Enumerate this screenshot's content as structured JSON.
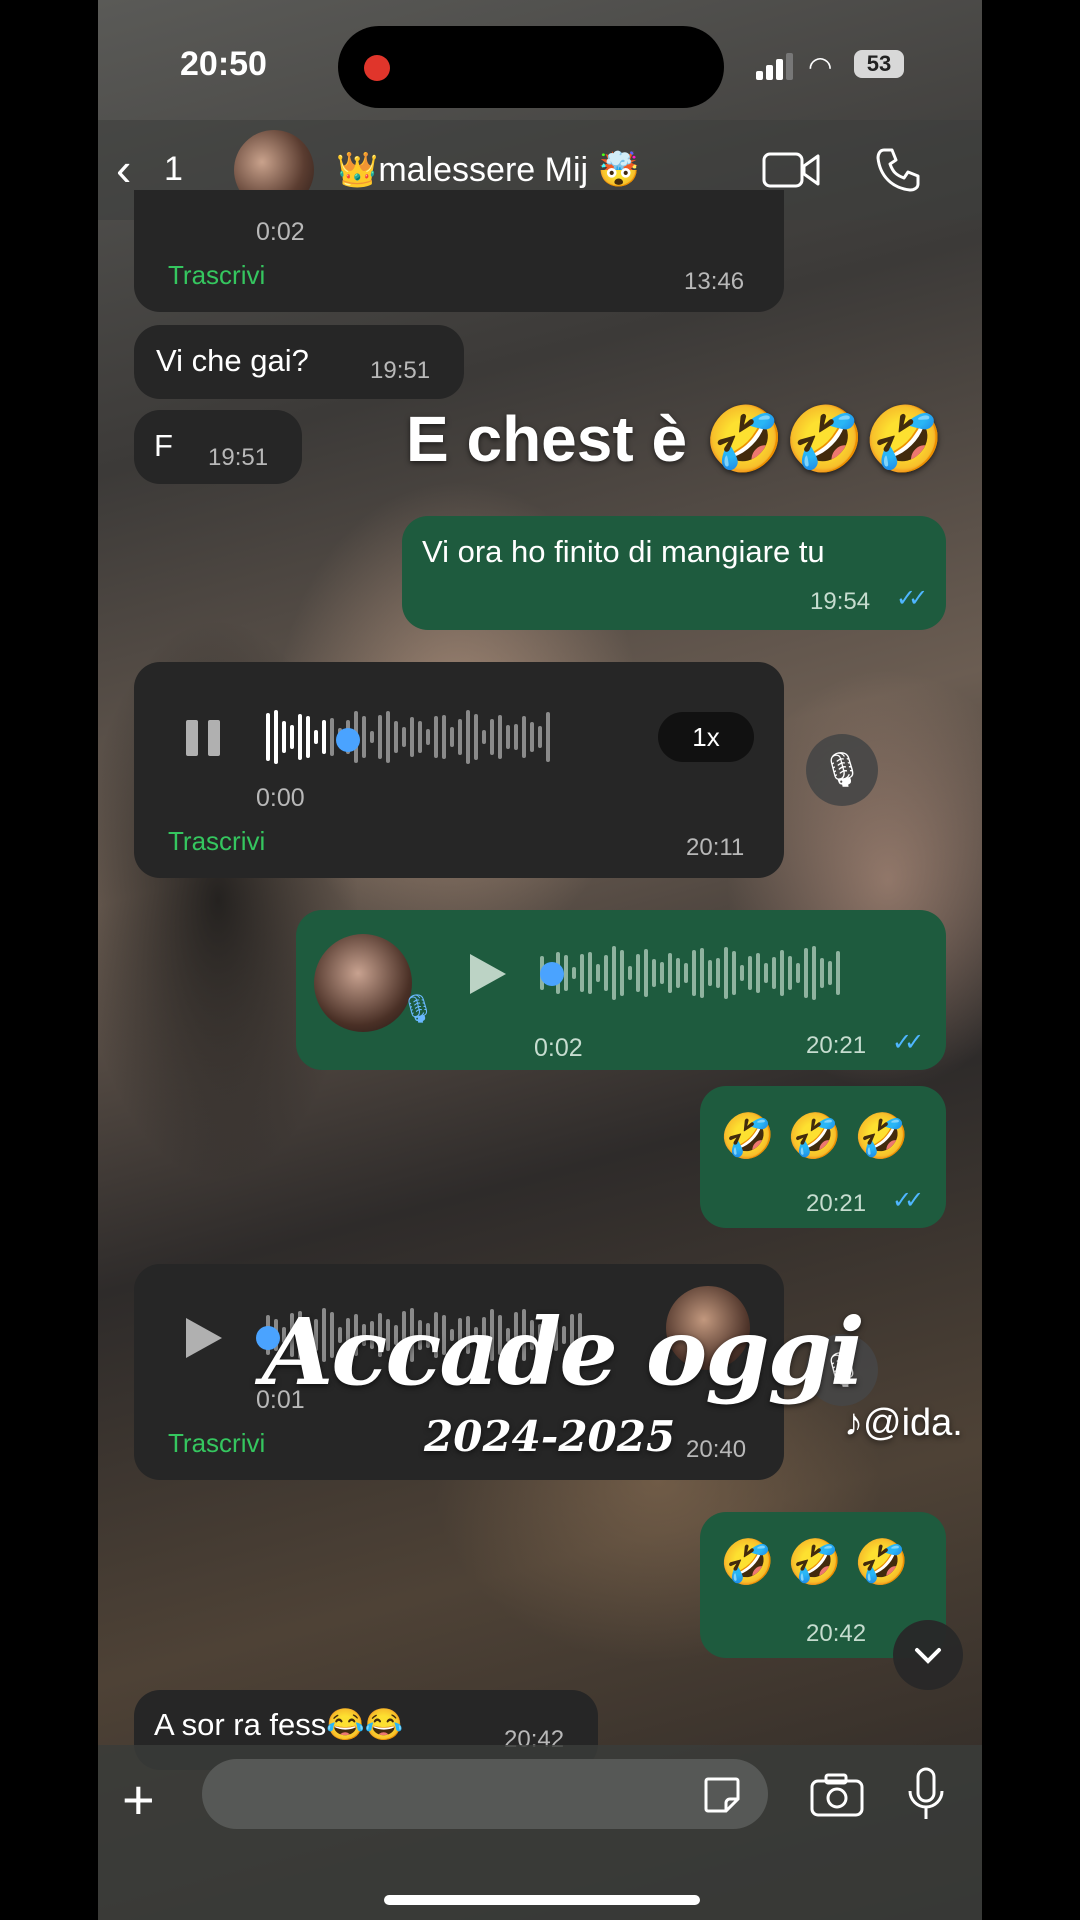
{
  "status_bar": {
    "time": "20:50",
    "battery": "53"
  },
  "header": {
    "back_count": "1",
    "title": "👑malessere Mij 🤯"
  },
  "messages": [
    {
      "dir": "in",
      "duration": "0:02",
      "transcribe": "Trascrivi",
      "time": "13:46"
    },
    {
      "dir": "in",
      "text": "Vi che gai?",
      "time": "19:51"
    },
    {
      "dir": "in",
      "text": "F",
      "time": "19:51"
    },
    {
      "dir": "out",
      "text": "Vi ora ho finito di mangiare tu",
      "time": "19:54"
    },
    {
      "dir": "in",
      "duration": "0:00",
      "speed": "1x",
      "transcribe": "Trascrivi",
      "time": "20:11"
    },
    {
      "dir": "out",
      "duration": "0:02",
      "time": "20:21"
    },
    {
      "dir": "out",
      "text": "🤣 🤣 🤣",
      "time": "20:21"
    },
    {
      "dir": "in",
      "duration": "0:01",
      "transcribe": "Trascrivi",
      "time": "20:40"
    },
    {
      "dir": "out",
      "text": "🤣 🤣 🤣",
      "time": "20:42"
    },
    {
      "dir": "in",
      "text": "A sor ra fess😂😂",
      "time": "20:42"
    }
  ],
  "overlay": {
    "caption": "E chest è 🤣🤣🤣",
    "title": "Accade oggi",
    "years": "2024-2025",
    "watermark": "@ida."
  },
  "icons": [
    "chevron-left-icon",
    "video-call-icon",
    "phone-icon",
    "mic-icon",
    "pause-icon",
    "play-icon",
    "plus-icon",
    "sticker-icon",
    "camera-icon",
    "chevron-down-icon"
  ],
  "colors": {
    "outgoing": "#1e5b3e",
    "incoming": "#262626",
    "transcribe": "#35c65f",
    "read_tick": "#4fb6ff"
  }
}
